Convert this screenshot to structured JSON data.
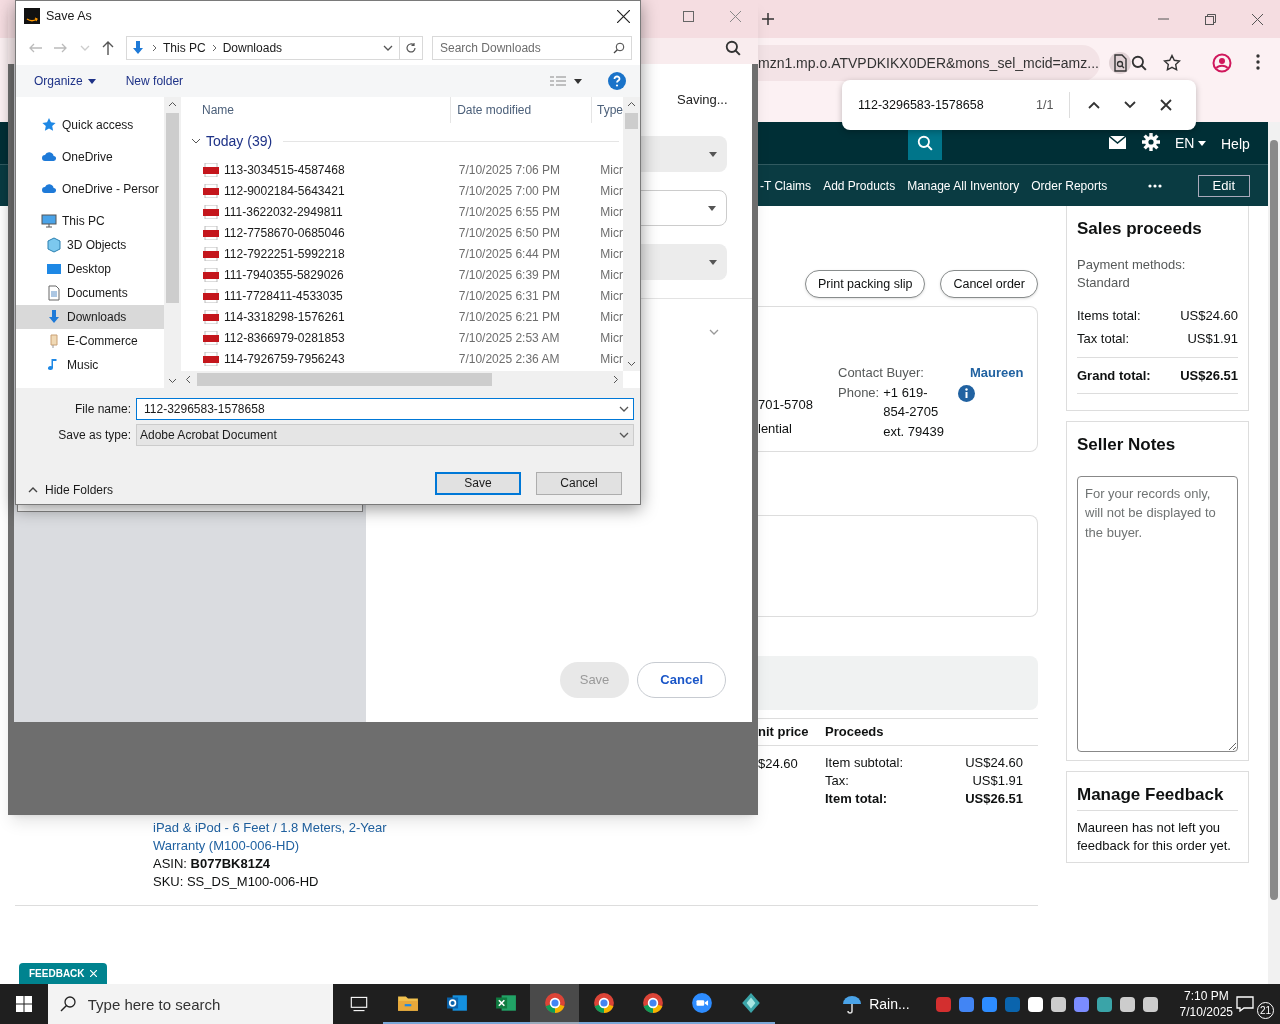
{
  "browser": {
    "url": "mzn1.mp.o.ATVPDKIKX0DER&mons_sel_mcid=amz...",
    "find_bar": {
      "query": "112-3296583-1578658",
      "count": "1/1"
    }
  },
  "seller_header": {
    "language": "EN",
    "help": "Help",
    "nav": [
      "-T Claims",
      "Add Products",
      "Manage All Inventory",
      "Order Reports"
    ],
    "edit": "Edit"
  },
  "order": {
    "buttons": [
      "Print packing slip",
      "Cancel order"
    ],
    "address_lines": [
      "701-5708",
      "lential"
    ],
    "contact": {
      "label": "Contact Buyer:",
      "name": "Maureen",
      "phone_label": "Phone:",
      "phone_lines": [
        "+1 619-",
        "854-2705",
        "ext. 79439"
      ]
    },
    "table": {
      "columns": [
        "nit price",
        "Proceeds"
      ],
      "unit_price": "$24.60",
      "proceeds": [
        {
          "label": "Item subtotal:",
          "value": "US$24.60",
          "bold": false
        },
        {
          "label": "Tax:",
          "value": "US$1.91",
          "bold": false
        },
        {
          "label": "Item total:",
          "value": "US$26.51",
          "bold": true
        }
      ]
    },
    "product": {
      "title_lines": [
        "iPad & iPod - 6 Feet / 1.8 Meters, 2-Year",
        "Warranty (M100-006-HD)"
      ],
      "asin_label": "ASIN:",
      "asin": "B077BK81Z4",
      "sku": "SKU: SS_DS_M100-006-HD"
    }
  },
  "sales_proceeds": {
    "title": "Sales proceeds",
    "payment": "Payment methods: Standard",
    "rows": [
      {
        "label": "Items total:",
        "value": "US$24.60",
        "bold": false
      },
      {
        "label": "Tax total:",
        "value": "US$1.91",
        "bold": false
      },
      {
        "label": "Grand total:",
        "value": "US$26.51",
        "bold": true
      }
    ]
  },
  "seller_notes": {
    "title": "Seller Notes",
    "placeholder": "For your records only, will not be displayed to the buyer."
  },
  "manage_feedback": {
    "title": "Manage Feedback",
    "text": "Maureen has not left you feedback for this order yet."
  },
  "print_dialog": {
    "status": "Saving...",
    "save": "Save",
    "save_disabled": true,
    "cancel": "Cancel"
  },
  "save_as": {
    "title": "Save As",
    "path": [
      "This PC",
      "Downloads"
    ],
    "search_placeholder": "Search Downloads",
    "toolbar": [
      "Organize",
      "New folder"
    ],
    "nav": [
      {
        "label": "Quick access",
        "kind": "star",
        "selected": false
      },
      {
        "label": "OneDrive",
        "kind": "cloud",
        "selected": false
      },
      {
        "label": "OneDrive - Persor",
        "kind": "cloud",
        "selected": false
      },
      {
        "label": "This PC",
        "kind": "pc",
        "selected": false,
        "children": [
          {
            "label": "3D Objects",
            "kind": "cube",
            "selected": false
          },
          {
            "label": "Desktop",
            "kind": "desktop",
            "selected": false
          },
          {
            "label": "Documents",
            "kind": "document",
            "selected": false
          },
          {
            "label": "Downloads",
            "kind": "download",
            "selected": true
          },
          {
            "label": "E-Commerce",
            "kind": "folder",
            "selected": false
          },
          {
            "label": "Music",
            "kind": "music",
            "selected": false
          }
        ]
      }
    ],
    "columns": [
      "Name",
      "Date modified",
      "Type"
    ],
    "group": {
      "label": "Today (39)",
      "expanded": true
    },
    "files": [
      {
        "name": "113-3034515-4587468",
        "date": "7/10/2025 7:06 PM",
        "type": "Micr"
      },
      {
        "name": "112-9002184-5643421",
        "date": "7/10/2025 7:00 PM",
        "type": "Micr"
      },
      {
        "name": "111-3622032-2949811",
        "date": "7/10/2025 6:55 PM",
        "type": "Micr"
      },
      {
        "name": "112-7758670-0685046",
        "date": "7/10/2025 6:50 PM",
        "type": "Micr"
      },
      {
        "name": "112-7922251-5992218",
        "date": "7/10/2025 6:44 PM",
        "type": "Micr"
      },
      {
        "name": "111-7940355-5829026",
        "date": "7/10/2025 6:39 PM",
        "type": "Micr"
      },
      {
        "name": "111-7728411-4533035",
        "date": "7/10/2025 6:31 PM",
        "type": "Micr"
      },
      {
        "name": "114-3318298-1576261",
        "date": "7/10/2025 6:21 PM",
        "type": "Micr"
      },
      {
        "name": "112-8366979-0281853",
        "date": "7/10/2025 2:53 AM",
        "type": "Micr"
      },
      {
        "name": "114-7926759-7956243",
        "date": "7/10/2025 2:36 AM",
        "type": "Micr"
      }
    ],
    "file_name_label": "File name:",
    "file_name": "112-3296583-1578658",
    "type_label": "Save as type:",
    "save_as_type": "Adobe Acrobat Document",
    "hide_folders": "Hide Folders",
    "buttons": [
      "Save",
      "Cancel"
    ]
  },
  "feedback_tab": "FEEDBACK",
  "taskbar": {
    "search_placeholder": "Type here to search",
    "apps": [
      {
        "kind": "taskview",
        "active": false
      },
      {
        "kind": "explorer",
        "active": false
      },
      {
        "kind": "outlook",
        "active": false
      },
      {
        "kind": "excel",
        "active": false
      },
      {
        "kind": "chrome",
        "active": true
      },
      {
        "kind": "chrome",
        "active": false
      },
      {
        "kind": "chrome",
        "active": false
      },
      {
        "kind": "zoom",
        "active": false
      },
      {
        "kind": "app",
        "active": false
      }
    ],
    "weather": "Rain...",
    "time": "7:10 PM",
    "date": "7/10/2025",
    "notifications": "21"
  }
}
